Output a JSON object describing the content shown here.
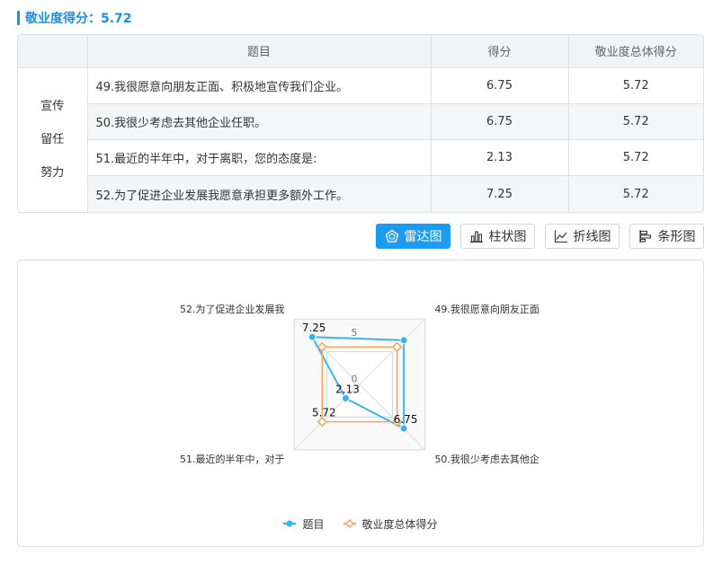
{
  "theme": {
    "accent": "#1a8fe3",
    "active_tab": "#1d9bf0",
    "row_alt": "#f5f6f8"
  },
  "header": {
    "title_label": "敬业度得分：",
    "title_value": "5.72"
  },
  "table": {
    "columns": [
      "题目",
      "得分",
      "敬业度总体得分"
    ],
    "group_lines": [
      "宣传",
      "留任",
      "努力"
    ],
    "rows": [
      {
        "question": "49.我很愿意向朋友正面、积极地宣传我们企业。",
        "score": "6.75",
        "overall": "5.72"
      },
      {
        "question": "50.我很少考虑去其他企业任职。",
        "score": "6.75",
        "overall": "5.72"
      },
      {
        "question": "51.最近的半年中，对于离职，您的态度是:",
        "score": "2.13",
        "overall": "5.72"
      },
      {
        "question": "52.为了促进企业发展我愿意承担更多额外工作。",
        "score": "7.25",
        "overall": "5.72"
      }
    ]
  },
  "chart_tabs": [
    {
      "label": "雷达图",
      "icon": "radar-chart-icon",
      "active": true
    },
    {
      "label": "柱状图",
      "icon": "bar-chart-icon",
      "active": false
    },
    {
      "label": "折线图",
      "icon": "line-chart-icon",
      "active": false
    },
    {
      "label": "条形图",
      "icon": "horizontal-bar-chart-icon",
      "active": false
    }
  ],
  "chart_data": {
    "type": "radar",
    "indicators": [
      "49.我很愿意向朋友正面",
      "50.我很少考虑去其他企",
      "51.最近的半年中，对于",
      "52.为了促进企业发展我"
    ],
    "radial_range": [
      0,
      10
    ],
    "radial_tick_labels": [
      "0",
      "5"
    ],
    "grid": true,
    "legend_position": "bottom-center",
    "series": [
      {
        "name": "题目",
        "values": [
          6.75,
          6.75,
          2.13,
          7.25
        ],
        "color": "#3ab4ee",
        "marker": "circle"
      },
      {
        "name": "敬业度总体得分",
        "values": [
          5.72,
          5.72,
          5.72,
          5.72
        ],
        "color": "#f5a25d",
        "marker": "diamond"
      }
    ]
  }
}
